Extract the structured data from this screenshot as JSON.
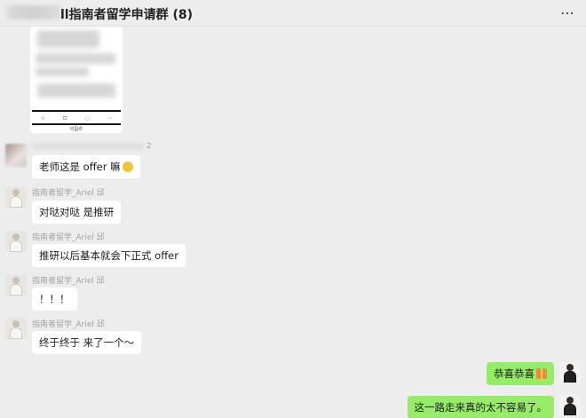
{
  "header": {
    "title": "ll指南者留学申请群 (8)",
    "more_icon": "⋯"
  },
  "shared_image": {
    "toolbar_icons": [
      "☆",
      "⊡",
      "◌",
      "⋯"
    ],
    "caption": "可副件"
  },
  "messages": [
    {
      "sender": "2",
      "text": "老师这是 offer 嘛",
      "emoji": "grin"
    },
    {
      "sender": "指南者留学_Ariel 邱",
      "text": "对哒对哒 是推研"
    },
    {
      "sender": "指南者留学_Ariel 邱",
      "text": "推研以后基本就会下正式 offer"
    },
    {
      "sender": "指南者留学_Ariel 邱",
      "text": "！！！"
    },
    {
      "sender": "指南者留学_Ariel 邱",
      "text": "终于终于 来了一个～"
    }
  ],
  "my_messages": [
    {
      "text": "恭喜恭喜",
      "emoji": "gift"
    },
    {
      "text": "这一路走来真的太不容易了。"
    }
  ]
}
